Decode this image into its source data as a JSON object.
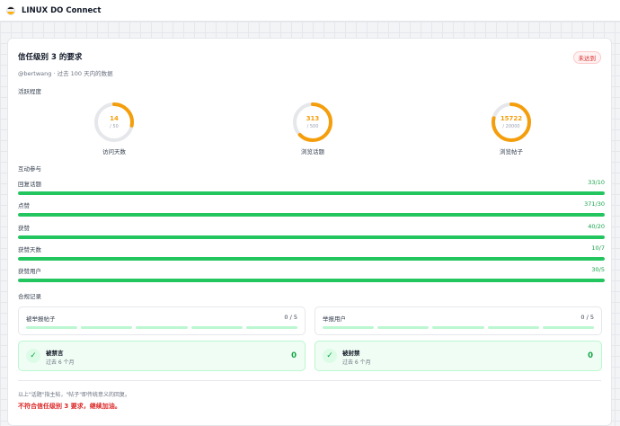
{
  "app": {
    "title": "LINUX DO Connect"
  },
  "colors": {
    "accent": "#22c55e",
    "warning": "#f59e0b",
    "danger": "#dc2626"
  },
  "card": {
    "title": "信任级别 3 的要求",
    "status": "未达到",
    "subtitle": "@bertwang · 过去 100 天内的数据"
  },
  "activity": {
    "label": "活跃程度",
    "rings": [
      {
        "value": "14",
        "total": "/ 50",
        "label": "访问天数",
        "progress": 0.28
      },
      {
        "value": "313",
        "total": "/ 500",
        "label": "浏览话题",
        "progress": 0.626
      },
      {
        "value": "15722",
        "total": "/ 20000",
        "label": "浏览帖子",
        "progress": 0.786
      }
    ]
  },
  "interaction": {
    "label": "互动参与",
    "bars": [
      {
        "label": "回复话题",
        "value": "33/10",
        "progress": 1
      },
      {
        "label": "点赞",
        "value": "371/30",
        "progress": 1
      },
      {
        "label": "获赞",
        "value": "40/20",
        "progress": 1
      },
      {
        "label": "获赞天数",
        "value": "10/7",
        "progress": 1
      },
      {
        "label": "获赞用户",
        "value": "30/5",
        "progress": 1
      }
    ]
  },
  "compliance": {
    "label": "合规记录",
    "flagged_posts": {
      "label": "被举报帖子",
      "value": "0 / 5"
    },
    "flagged_users": {
      "label": "举报用户",
      "value": "0 / 5"
    },
    "silenced": {
      "title": "被禁言",
      "sub": "过去 6 个月",
      "count": "0"
    },
    "suspended": {
      "title": "被封禁",
      "sub": "过去 6 个月",
      "count": "0"
    }
  },
  "footer": {
    "note": "以上\"话题\"指主帖，\"帖子\"即传统意义的回复。",
    "verdict": "不符合信任级别 3 要求，继续加油。"
  }
}
